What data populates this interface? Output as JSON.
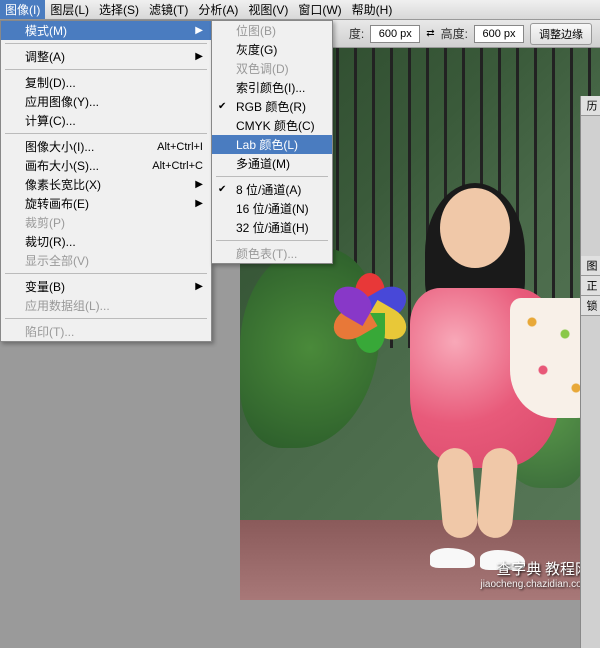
{
  "menubar": [
    {
      "label": "图像(I)",
      "active": true
    },
    {
      "label": "图层(L)"
    },
    {
      "label": "选择(S)"
    },
    {
      "label": "滤镜(T)"
    },
    {
      "label": "分析(A)"
    },
    {
      "label": "视图(V)"
    },
    {
      "label": "窗口(W)"
    },
    {
      "label": "帮助(H)"
    }
  ],
  "toolbar": {
    "width_label": "度:",
    "width_value": "600 px",
    "height_label": "高度:",
    "height_value": "600 px",
    "refine_btn": "调整边缘"
  },
  "menu_image": {
    "mode": "模式(M)",
    "adjust": "调整(A)",
    "duplicate": "复制(D)...",
    "apply_image": "应用图像(Y)...",
    "calculations": "计算(C)...",
    "image_size": "图像大小(I)...",
    "image_size_sc": "Alt+Ctrl+I",
    "canvas_size": "画布大小(S)...",
    "canvas_size_sc": "Alt+Ctrl+C",
    "pixel_ratio": "像素长宽比(X)",
    "rotate": "旋转画布(E)",
    "crop": "裁剪(P)",
    "trim": "裁切(R)...",
    "reveal_all": "显示全部(V)",
    "variables": "变量(B)",
    "apply_data": "应用数据组(L)...",
    "trap": "陷印(T)..."
  },
  "menu_mode": {
    "bitmap": "位图(B)",
    "grayscale": "灰度(G)",
    "duotone": "双色调(D)",
    "indexed": "索引颜色(I)...",
    "rgb": "RGB 颜色(R)",
    "cmyk": "CMYK 颜色(C)",
    "lab": "Lab 颜色(L)",
    "multichannel": "多通道(M)",
    "b8": "8 位/通道(A)",
    "b16": "16 位/通道(N)",
    "b32": "32 位/通道(H)",
    "colortable": "颜色表(T)..."
  },
  "panels": {
    "history": "历",
    "layers": "图",
    "normal": "正",
    "lock": "锁"
  },
  "watermark": {
    "line1": "查字典 教程网",
    "line2": "jiaocheng.chazidian.com"
  }
}
